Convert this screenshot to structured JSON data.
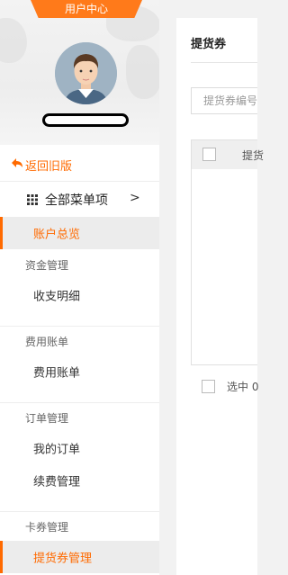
{
  "sidebar": {
    "user_center_tab": "用户中心",
    "back_label": "返回旧版",
    "all_menu_label": "全部菜单项",
    "chevron": ">",
    "active_item": "账户总览",
    "sections": [
      {
        "title": "资金管理",
        "items": [
          "收支明细"
        ]
      },
      {
        "title": "费用账单",
        "items": [
          "费用账单"
        ]
      },
      {
        "title": "订单管理",
        "items": [
          "我的订单",
          "续费管理"
        ]
      },
      {
        "title": "卡券管理",
        "items": [
          "提货券管理"
        ]
      }
    ]
  },
  "main": {
    "title": "提货券",
    "search_placeholder": "提货券编号",
    "table_header": "提货",
    "selected_text": "选中 0"
  },
  "colors": {
    "accent": "#ff6a00",
    "tab": "#ff7a1a"
  },
  "icons": [
    "back-arrow-icon",
    "grid-icon",
    "chevron-right-icon",
    "avatar"
  ]
}
